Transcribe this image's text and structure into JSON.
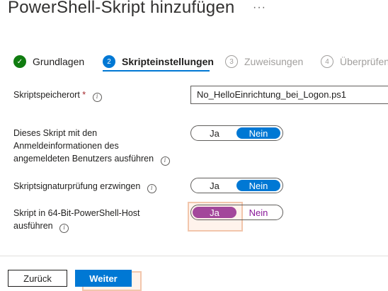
{
  "header": {
    "title": "PowerShell-Skript hinzufügen",
    "more_label": "···"
  },
  "steps": [
    {
      "number": "✓",
      "label": "Grundlagen",
      "state": "done"
    },
    {
      "number": "2",
      "label": "Skripteinstellungen",
      "state": "active"
    },
    {
      "number": "3",
      "label": "Zuweisungen",
      "state": "todo"
    },
    {
      "number": "4",
      "label": "Überprüfen",
      "state": "todo"
    }
  ],
  "form": {
    "script_location": {
      "label": "Skriptspeicherort",
      "required_mark": "*",
      "value": "No_HelloEinrichtung_bei_Logon.ps1"
    },
    "run_as_user": {
      "label_line1": "Dieses Skript mit den",
      "label_line2": "Anmeldeinformationen des",
      "label_line3": "angemeldeten Benutzers ausführen",
      "yes": "Ja",
      "no": "Nein",
      "selected": "Nein"
    },
    "enforce_signature": {
      "label": "Skriptsignaturprüfung erzwingen",
      "yes": "Ja",
      "no": "Nein",
      "selected": "Nein"
    },
    "run_64bit": {
      "label_line1": "Skript in 64-Bit-PowerShell-Host",
      "label_line2": "ausführen",
      "yes": "Ja",
      "no": "Nein",
      "selected": "Ja"
    }
  },
  "footer": {
    "back_label": "Zurück",
    "next_label": "Weiter"
  },
  "colors": {
    "accent": "#0078d4",
    "success": "#107c10",
    "selected_purple": "#a3479b",
    "highlight": "#e8a078"
  },
  "icons": {
    "info": "info-icon",
    "more": "more-icon",
    "check": "checkmark-icon"
  }
}
